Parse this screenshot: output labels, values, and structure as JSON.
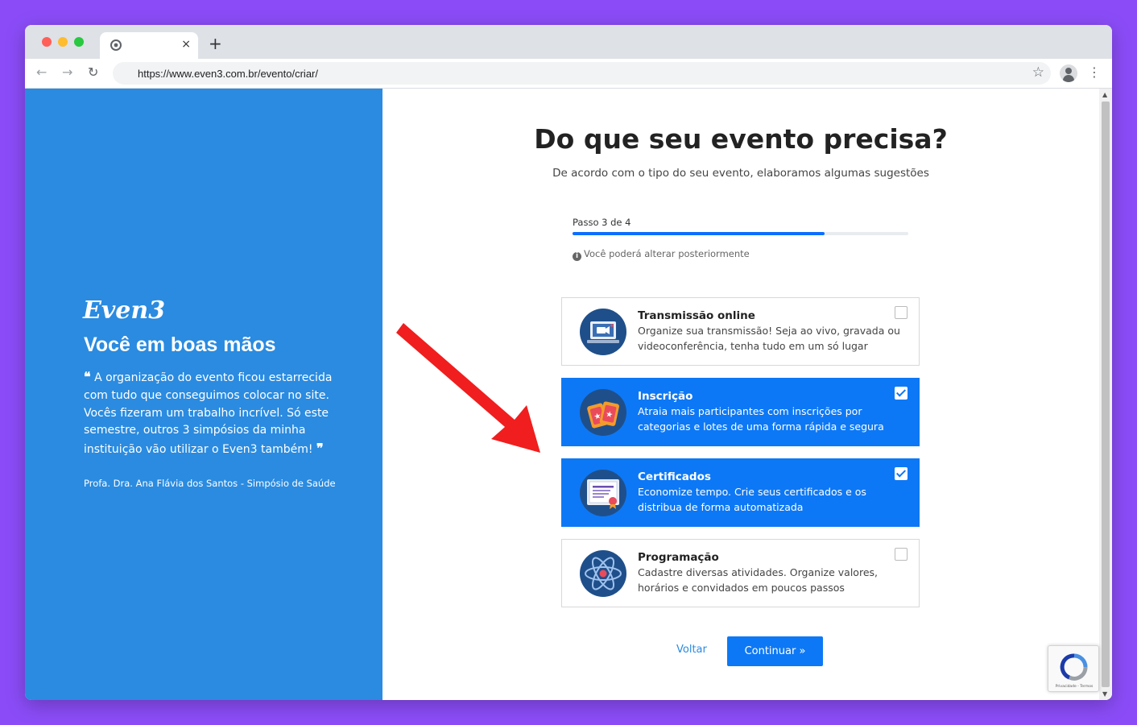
{
  "browser": {
    "url": "https://www.even3.com.br/evento/criar/",
    "tab_close": "×",
    "new_tab": "+"
  },
  "sidebar": {
    "logo": "Even3",
    "headline": "Você em boas mãos",
    "testimonial": "A organização do evento ficou estarrecida com tudo que conseguimos colocar no site. Vocês fizeram um trabalho incrível. Só este semestre, outros 3 simpósios da minha instituição vão utilizar o Even3 também!",
    "author": "Profa. Dra. Ana Flávia dos Santos - Simpósio de Saúde"
  },
  "main": {
    "title": "Do que seu evento precisa?",
    "subtitle": "De acordo com o tipo do seu evento, elaboramos algumas sugestões",
    "step_label": "Passo 3 de 4",
    "progress": 0.75,
    "hint": "Você poderá alterar posteriormente",
    "options": [
      {
        "title": "Transmissão online",
        "description": "Organize sua transmissão! Seja ao vivo, gravada ou videoconferência, tenha tudo em um só lugar",
        "selected": false,
        "icon": "video-broadcast-icon"
      },
      {
        "title": "Inscrição",
        "description": "Atraia mais participantes com inscrições por categorias e lotes de uma forma rápida e segura",
        "selected": true,
        "icon": "ticket-icon"
      },
      {
        "title": "Certificados",
        "description": "Economize tempo. Crie seus certificados e os distribua de forma automatizada",
        "selected": true,
        "icon": "certificate-icon"
      },
      {
        "title": "Programação",
        "description": "Cadastre diversas atividades. Organize valores, horários e convidados em poucos passos",
        "selected": false,
        "icon": "atom-icon"
      }
    ],
    "back_label": "Voltar",
    "continue_label": "Continuar »"
  },
  "recaptcha": {
    "text": "Privacidade - Termos"
  },
  "colors": {
    "page_background": "#8b4cf7",
    "sidebar": "#2a8be0",
    "accent": "#0d78f5",
    "annotation_arrow": "#f01e1e"
  }
}
